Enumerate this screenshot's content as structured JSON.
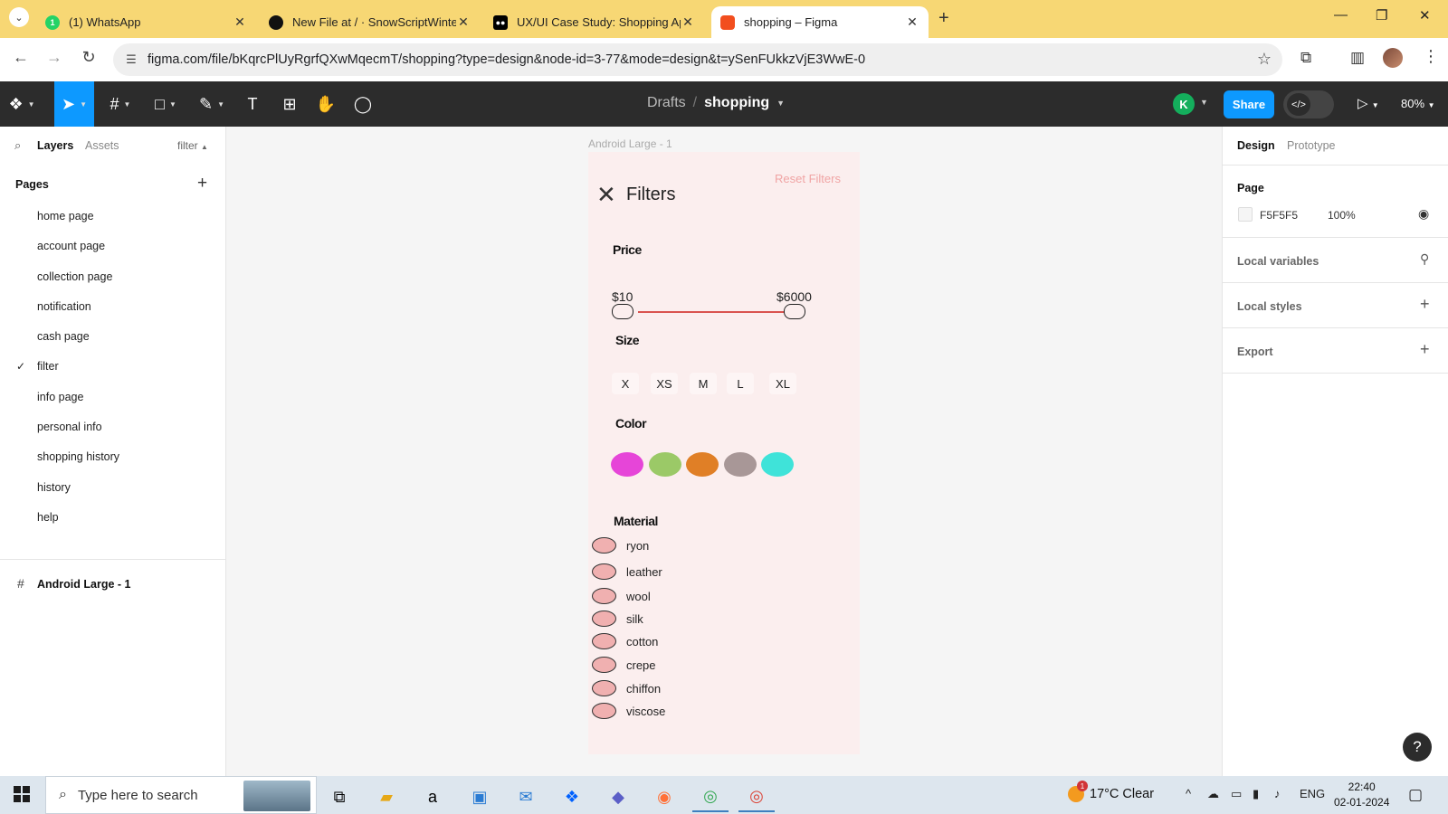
{
  "browser": {
    "tabs": [
      {
        "title": "(1) WhatsApp",
        "icon": "whatsapp-icon",
        "color": "#25d366",
        "badge": "1"
      },
      {
        "title": "New File at / · SnowScriptWinte",
        "icon": "github-icon",
        "color": "#111111"
      },
      {
        "title": "UX/UI Case Study: Shopping Ap",
        "icon": "medium-icon",
        "color": "#000000"
      },
      {
        "title": "shopping – Figma",
        "icon": "figma-icon",
        "color": "#f24e1e"
      }
    ],
    "url": "figma.com/file/bKqrcPlUyRgrfQXwMqecmT/shopping?type=design&node-id=3-77&mode=design&t=ySenFUkkzVjE3WwE-0"
  },
  "figma_toolbar": {
    "breadcrumb_drafts": "Drafts",
    "breadcrumb_sep": "/",
    "file_name": "shopping",
    "user_initial": "K",
    "share_label": "Share",
    "zoom": "80%"
  },
  "left_panel": {
    "tab_layers": "Layers",
    "tab_assets": "Assets",
    "current_page_filter": "filter",
    "pages_header": "Pages",
    "pages": [
      {
        "name": "home page",
        "checked": false
      },
      {
        "name": "account page",
        "checked": false
      },
      {
        "name": "collection page",
        "checked": false
      },
      {
        "name": "notification",
        "checked": false
      },
      {
        "name": "cash page",
        "checked": false
      },
      {
        "name": "filter",
        "checked": true
      },
      {
        "name": "info page",
        "checked": false
      },
      {
        "name": "personal info",
        "checked": false
      },
      {
        "name": "shopping history",
        "checked": false
      },
      {
        "name": "history",
        "checked": false
      },
      {
        "name": "help",
        "checked": false
      }
    ],
    "layer_name": "Android Large - 1"
  },
  "canvas": {
    "frame_label": "Android Large - 1",
    "filters": {
      "title": "Filters",
      "reset": "Reset Filters",
      "price_label": "Price",
      "price_min": "$10",
      "price_max": "$6000",
      "size_label": "Size",
      "sizes": [
        "X",
        "XS",
        "M",
        "L",
        "XL"
      ],
      "color_label": "Color",
      "colors": [
        "#e645d8",
        "#9bc967",
        "#e07f26",
        "#a89797",
        "#3fe3d9"
      ],
      "material_label": "Material",
      "materials": [
        "ryon",
        "leather",
        "wool",
        "silk",
        "cotton",
        "crepe",
        "chiffon",
        "viscose"
      ]
    }
  },
  "right_panel": {
    "tab_design": "Design",
    "tab_prototype": "Prototype",
    "page_header": "Page",
    "page_color": "F5F5F5",
    "page_opacity": "100%",
    "local_variables": "Local variables",
    "local_styles": "Local styles",
    "export": "Export"
  },
  "taskbar": {
    "search_placeholder": "Type here to search",
    "weather": "17°C  Clear",
    "weather_badge": "1",
    "lang": "ENG",
    "time": "22:40",
    "date": "02-01-2024"
  }
}
